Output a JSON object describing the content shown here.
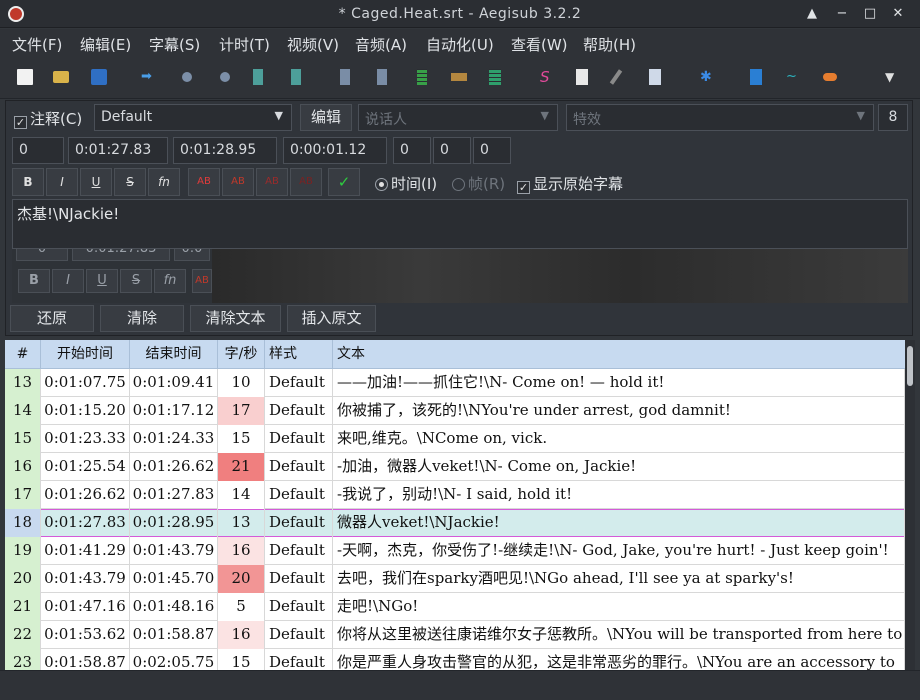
{
  "window": {
    "title": "* Caged.Heat.srt - Aegisub 3.2.2"
  },
  "menu": [
    "文件(F)",
    "编辑(E)",
    "字幕(S)",
    "计时(T)",
    "视频(V)",
    "音频(A)",
    "自动化(U)",
    "查看(W)",
    "帮助(H)"
  ],
  "toolbar": {
    "icons": [
      "new-file-icon",
      "open-file-icon",
      "save-icon",
      "jump-to-icon",
      "zoom-in-icon",
      "zoom-out-icon",
      "snap-start-icon",
      "snap-end-icon",
      "video-start-icon",
      "video-end-icon",
      "grid-icon",
      "film-icon",
      "grid-color-icon",
      "style-manager-icon",
      "properties-icon",
      "attachments-icon",
      "fonts-icon",
      "automation-icon",
      "shift-times-icon",
      "timing-post-icon",
      "audio-icon",
      "dropdown-icon"
    ]
  },
  "editor": {
    "comment_label": "注释(C)",
    "style_value": "Default",
    "edit_button": "编辑",
    "actor_placeholder": "说话人",
    "effect_placeholder": "特效",
    "line_count": "8",
    "layer": "0",
    "start_time": "0:01:27.83",
    "end_time": "0:01:28.95",
    "duration": "0:00:01.12",
    "margin_l": "0",
    "margin_r": "0",
    "margin_v": "0",
    "format_buttons": [
      "B",
      "I",
      "U",
      "S",
      "fn",
      "AB",
      "AB",
      "AB",
      "AB",
      "✓"
    ],
    "time_radio": "时间(I)",
    "frame_radio": "帧(R)",
    "show_original": "显示原始字幕",
    "text": "杰基!\\NJackie!",
    "ghost_layer": "0",
    "ghost_start": "0:01:27.83",
    "ghost_end": "0:0",
    "ghost_formats": [
      "B",
      "I",
      "U",
      "S",
      "fn",
      "AB"
    ],
    "actions": [
      "还原",
      "清除",
      "清除文本",
      "插入原文"
    ]
  },
  "grid": {
    "headers": [
      "#",
      "开始时间",
      "结束时间",
      "字/秒",
      "样式",
      "文本"
    ],
    "rows": [
      {
        "n": "13",
        "start": "0:01:07.75",
        "end": "0:01:09.41",
        "cps": "10",
        "style": "Default",
        "text": "——加油!——抓住它!\\N- Come on! — hold it!",
        "cps_color": "#ffffff"
      },
      {
        "n": "14",
        "start": "0:01:15.20",
        "end": "0:01:17.12",
        "cps": "17",
        "style": "Default",
        "text": "你被捕了，该死的!\\NYou're under arrest, god damnit!",
        "cps_color": "#f9cfcf"
      },
      {
        "n": "15",
        "start": "0:01:23.33",
        "end": "0:01:24.33",
        "cps": "15",
        "style": "Default",
        "text": "来吧,维克。\\NCome on, vick.",
        "cps_color": "#ffffff"
      },
      {
        "n": "16",
        "start": "0:01:25.54",
        "end": "0:01:26.62",
        "cps": "21",
        "style": "Default",
        "text": "-加油，微器人veket!\\N- Come on, Jackie!",
        "cps_color": "#f07f7f"
      },
      {
        "n": "17",
        "start": "0:01:26.62",
        "end": "0:01:27.83",
        "cps": "14",
        "style": "Default",
        "text": "-我说了，别动!\\N- I said, hold it!",
        "cps_color": "#ffffff"
      },
      {
        "n": "18",
        "start": "0:01:27.83",
        "end": "0:01:28.95",
        "cps": "13",
        "style": "Default",
        "text": "微器人veket!\\NJackie!",
        "cps_color": "#d3ecec",
        "selected": true
      },
      {
        "n": "19",
        "start": "0:01:41.29",
        "end": "0:01:43.79",
        "cps": "16",
        "style": "Default",
        "text": "-天啊，杰克，你受伤了!-继续走!\\N- God, Jake, you're hurt! - Just keep goin'!",
        "cps_color": "#fbe3e3"
      },
      {
        "n": "20",
        "start": "0:01:43.79",
        "end": "0:01:45.70",
        "cps": "20",
        "style": "Default",
        "text": "去吧，我们在sparky酒吧见!\\NGo ahead, I'll see ya at sparky's!",
        "cps_color": "#f29595"
      },
      {
        "n": "21",
        "start": "0:01:47.16",
        "end": "0:01:48.16",
        "cps": "5",
        "style": "Default",
        "text": "走吧!\\NGo!",
        "cps_color": "#ffffff"
      },
      {
        "n": "22",
        "start": "0:01:53.62",
        "end": "0:01:58.87",
        "cps": "16",
        "style": "Default",
        "text": "你将从这里被送往康诺维尔女子惩教所。\\NYou will be transported from here to",
        "cps_color": "#fbe3e3"
      },
      {
        "n": "23",
        "start": "0:01:58.87",
        "end": "0:02:05.75",
        "cps": "15",
        "style": "Default",
        "text": "你是严重人身攻击警官的从犯，这是非常恶劣的罪行。\\NYou are an accessory to",
        "cps_color": "#ffffff"
      }
    ]
  },
  "colors": {
    "row_number_bg": "#d6f0d0",
    "selected_number_bg": "#c8d9ef",
    "header_bg": "#c7daf0",
    "selection_border": "#d45bd8"
  }
}
